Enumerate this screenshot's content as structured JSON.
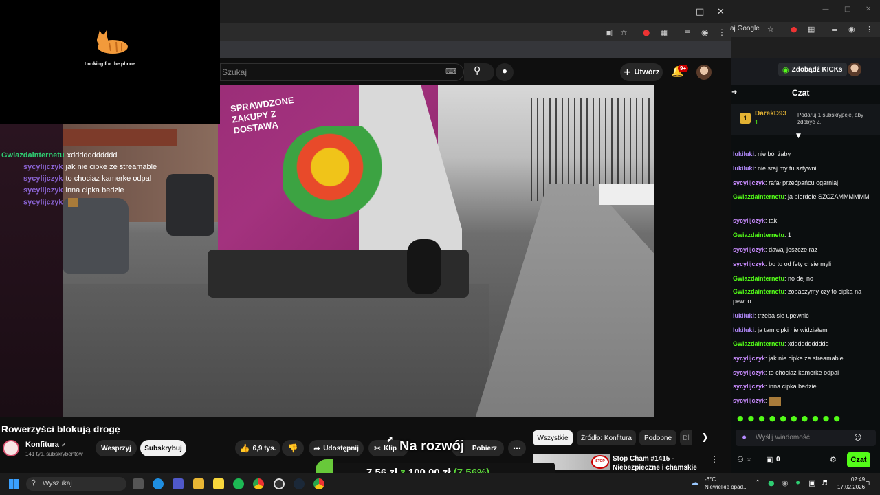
{
  "overlay": {
    "caption": "Looking for the phone"
  },
  "youtube": {
    "search_placeholder": "Szukaj",
    "create_label": "Utwórz",
    "notif_badge": "9+",
    "video_title": "Rowerzyści blokują drogę",
    "channel_name": "Konfitura",
    "channel_subs": "141 tys. subskrybentów",
    "support_label": "Wesprzyj",
    "subscribe_label": "Subskrybuj",
    "likes_label": "6,9 tys.",
    "share_label": "Udostępnij",
    "clip_label": "Klip",
    "download_label": "Pobierz",
    "chips": [
      "Wszystkie",
      "Źródło: Konfitura",
      "Podobne",
      "Dl"
    ],
    "rec_title": "Stop Cham #1415 - Niebezpieczne i chamskie",
    "truck_text": "SPRAWDZONE ZAKUPY Z DOSTAWĄ"
  },
  "stream_overlay": {
    "goal_label": "Na rozwój",
    "goal_current": "7,56 zł",
    "goal_sep": "z",
    "goal_target": "100,00 zł",
    "goal_percent": "(7.56%)",
    "goal_fraction": 0.0756,
    "chat": [
      {
        "user": "Gwiazdainternetu",
        "msg": "xddddddddddd",
        "green": true
      },
      {
        "user": "sycylijczyk",
        "msg": "jak nie cipke ze streamable",
        "green": false
      },
      {
        "user": "sycylijczyk",
        "msg": "to chociaz kamerke odpal",
        "green": false
      },
      {
        "user": "sycylijczyk",
        "msg": "inna cipka bedzie",
        "green": false
      },
      {
        "user": "sycylijczyk",
        "msg": "",
        "green": false
      }
    ]
  },
  "kick": {
    "browser_text": "aj Google",
    "get_kicks": "Zdobądź KICKs",
    "chat_title": "Czat",
    "pinned_user": "DarekD93",
    "pinned_count": "1",
    "pinned_badge": "1",
    "pinned_text": "Podaruj 1 subskrypcję, aby zdobyć 2.",
    "messages": [
      {
        "user": "lukiluki",
        "msg": "nie bój żaby",
        "color": "purple"
      },
      {
        "user": "lukiluki",
        "msg": "nie sraj my tu sztywni",
        "color": "purple"
      },
      {
        "user": "sycylijczyk",
        "msg": "rafał przećpańcu ogarniaj",
        "color": "purple"
      },
      {
        "user": "Gwiazdainternetu",
        "msg": "ja pierdole SZCZAMMMMMM",
        "color": "green"
      },
      {
        "user": "sycylijczyk",
        "msg": "tak",
        "color": "purple"
      },
      {
        "user": "Gwiazdainternetu",
        "msg": "1",
        "color": "green"
      },
      {
        "user": "sycylijczyk",
        "msg": "dawaj jeszcze raz",
        "color": "purple"
      },
      {
        "user": "sycylijczyk",
        "msg": "bo to od fety ci sie myli",
        "color": "purple"
      },
      {
        "user": "Gwiazdainternetu",
        "msg": "no dej no",
        "color": "green"
      },
      {
        "user": "Gwiazdainternetu",
        "msg": "zobaczymy czy to cipka na pewno",
        "color": "green"
      },
      {
        "user": "lukiluki",
        "msg": "trzeba sie upewnić",
        "color": "purple"
      },
      {
        "user": "lukiluki",
        "msg": "ja tam cipki nie widziałem",
        "color": "purple"
      },
      {
        "user": "Gwiazdainternetu",
        "msg": "xddddddddddd",
        "color": "green"
      },
      {
        "user": "sycylijczyk",
        "msg": "jak nie cipke ze streamable",
        "color": "purple"
      },
      {
        "user": "sycylijczyk",
        "msg": "to chociaz kamerke odpal",
        "color": "purple"
      },
      {
        "user": "sycylijczyk",
        "msg": "inna cipka bedzie",
        "color": "purple"
      },
      {
        "user": "sycylijczyk",
        "msg": "",
        "color": "purple"
      }
    ],
    "input_placeholder": "Wyślij wiadomość",
    "viewer_count": "0",
    "send_label": "Czat"
  },
  "taskbar": {
    "search_label": "Wyszukaj",
    "temperature": "-6°C",
    "weather": "Niewielkie opad...",
    "time": "02:49",
    "date": "17.02.2026"
  }
}
